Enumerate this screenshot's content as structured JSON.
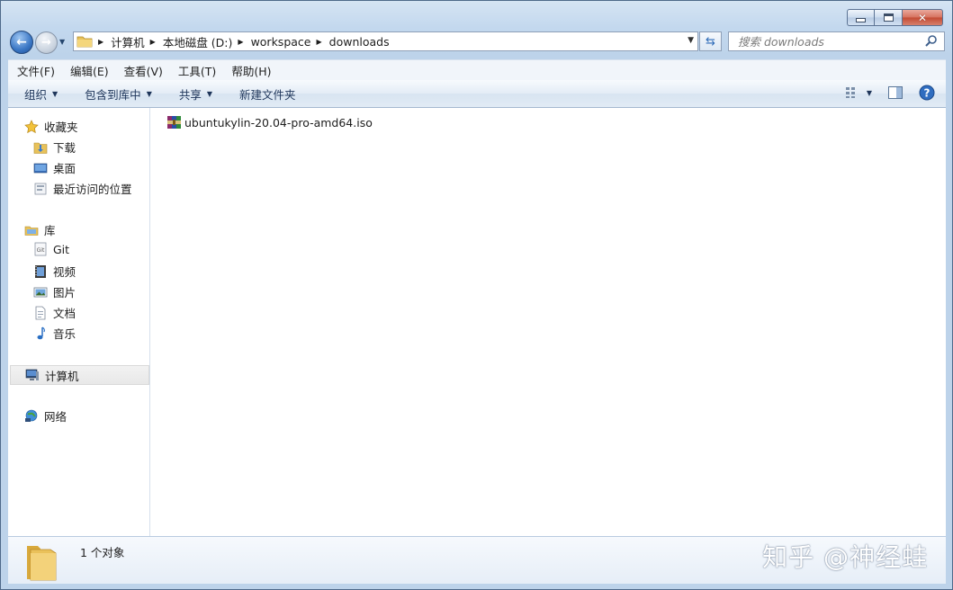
{
  "address": {
    "crumbs": [
      "计算机",
      "本地磁盘 (D:)",
      "workspace",
      "downloads"
    ]
  },
  "search": {
    "placeholder": "搜索 downloads"
  },
  "menu": [
    "文件(F)",
    "编辑(E)",
    "查看(V)",
    "工具(T)",
    "帮助(H)"
  ],
  "toolbar": {
    "organize": "组织",
    "include_in_library": "包含到库中",
    "share": "共享",
    "new_folder": "新建文件夹"
  },
  "sidebar": {
    "favorites": "收藏夹",
    "favorites_items": [
      "下载",
      "桌面",
      "最近访问的位置"
    ],
    "libraries": "库",
    "libraries_items": [
      "Git",
      "视频",
      "图片",
      "文档",
      "音乐"
    ],
    "computer": "计算机",
    "network": "网络"
  },
  "files": [
    {
      "name": "ubuntukylin-20.04-pro-amd64.iso",
      "icon": "winrar-archive-icon"
    }
  ],
  "status": {
    "count": "1 个对象"
  },
  "watermark": "知乎 @神经蛙",
  "colors": {
    "accent": "#3a76c4",
    "frame": "#bdd3ea",
    "selected": "#e8e8e8"
  }
}
